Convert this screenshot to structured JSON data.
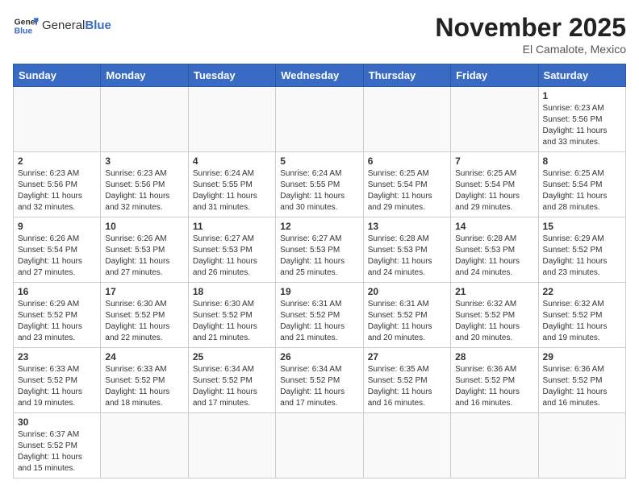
{
  "header": {
    "logo_general": "General",
    "logo_blue": "Blue",
    "month_title": "November 2025",
    "location": "El Camalote, Mexico"
  },
  "weekdays": [
    "Sunday",
    "Monday",
    "Tuesday",
    "Wednesday",
    "Thursday",
    "Friday",
    "Saturday"
  ],
  "weeks": [
    [
      {
        "day": "",
        "info": ""
      },
      {
        "day": "",
        "info": ""
      },
      {
        "day": "",
        "info": ""
      },
      {
        "day": "",
        "info": ""
      },
      {
        "day": "",
        "info": ""
      },
      {
        "day": "",
        "info": ""
      },
      {
        "day": "1",
        "info": "Sunrise: 6:23 AM\nSunset: 5:56 PM\nDaylight: 11 hours\nand 33 minutes."
      }
    ],
    [
      {
        "day": "2",
        "info": "Sunrise: 6:23 AM\nSunset: 5:56 PM\nDaylight: 11 hours\nand 32 minutes."
      },
      {
        "day": "3",
        "info": "Sunrise: 6:23 AM\nSunset: 5:56 PM\nDaylight: 11 hours\nand 32 minutes."
      },
      {
        "day": "4",
        "info": "Sunrise: 6:24 AM\nSunset: 5:55 PM\nDaylight: 11 hours\nand 31 minutes."
      },
      {
        "day": "5",
        "info": "Sunrise: 6:24 AM\nSunset: 5:55 PM\nDaylight: 11 hours\nand 30 minutes."
      },
      {
        "day": "6",
        "info": "Sunrise: 6:25 AM\nSunset: 5:54 PM\nDaylight: 11 hours\nand 29 minutes."
      },
      {
        "day": "7",
        "info": "Sunrise: 6:25 AM\nSunset: 5:54 PM\nDaylight: 11 hours\nand 29 minutes."
      },
      {
        "day": "8",
        "info": "Sunrise: 6:25 AM\nSunset: 5:54 PM\nDaylight: 11 hours\nand 28 minutes."
      }
    ],
    [
      {
        "day": "9",
        "info": "Sunrise: 6:26 AM\nSunset: 5:54 PM\nDaylight: 11 hours\nand 27 minutes."
      },
      {
        "day": "10",
        "info": "Sunrise: 6:26 AM\nSunset: 5:53 PM\nDaylight: 11 hours\nand 27 minutes."
      },
      {
        "day": "11",
        "info": "Sunrise: 6:27 AM\nSunset: 5:53 PM\nDaylight: 11 hours\nand 26 minutes."
      },
      {
        "day": "12",
        "info": "Sunrise: 6:27 AM\nSunset: 5:53 PM\nDaylight: 11 hours\nand 25 minutes."
      },
      {
        "day": "13",
        "info": "Sunrise: 6:28 AM\nSunset: 5:53 PM\nDaylight: 11 hours\nand 24 minutes."
      },
      {
        "day": "14",
        "info": "Sunrise: 6:28 AM\nSunset: 5:53 PM\nDaylight: 11 hours\nand 24 minutes."
      },
      {
        "day": "15",
        "info": "Sunrise: 6:29 AM\nSunset: 5:52 PM\nDaylight: 11 hours\nand 23 minutes."
      }
    ],
    [
      {
        "day": "16",
        "info": "Sunrise: 6:29 AM\nSunset: 5:52 PM\nDaylight: 11 hours\nand 23 minutes."
      },
      {
        "day": "17",
        "info": "Sunrise: 6:30 AM\nSunset: 5:52 PM\nDaylight: 11 hours\nand 22 minutes."
      },
      {
        "day": "18",
        "info": "Sunrise: 6:30 AM\nSunset: 5:52 PM\nDaylight: 11 hours\nand 21 minutes."
      },
      {
        "day": "19",
        "info": "Sunrise: 6:31 AM\nSunset: 5:52 PM\nDaylight: 11 hours\nand 21 minutes."
      },
      {
        "day": "20",
        "info": "Sunrise: 6:31 AM\nSunset: 5:52 PM\nDaylight: 11 hours\nand 20 minutes."
      },
      {
        "day": "21",
        "info": "Sunrise: 6:32 AM\nSunset: 5:52 PM\nDaylight: 11 hours\nand 20 minutes."
      },
      {
        "day": "22",
        "info": "Sunrise: 6:32 AM\nSunset: 5:52 PM\nDaylight: 11 hours\nand 19 minutes."
      }
    ],
    [
      {
        "day": "23",
        "info": "Sunrise: 6:33 AM\nSunset: 5:52 PM\nDaylight: 11 hours\nand 19 minutes."
      },
      {
        "day": "24",
        "info": "Sunrise: 6:33 AM\nSunset: 5:52 PM\nDaylight: 11 hours\nand 18 minutes."
      },
      {
        "day": "25",
        "info": "Sunrise: 6:34 AM\nSunset: 5:52 PM\nDaylight: 11 hours\nand 17 minutes."
      },
      {
        "day": "26",
        "info": "Sunrise: 6:34 AM\nSunset: 5:52 PM\nDaylight: 11 hours\nand 17 minutes."
      },
      {
        "day": "27",
        "info": "Sunrise: 6:35 AM\nSunset: 5:52 PM\nDaylight: 11 hours\nand 16 minutes."
      },
      {
        "day": "28",
        "info": "Sunrise: 6:36 AM\nSunset: 5:52 PM\nDaylight: 11 hours\nand 16 minutes."
      },
      {
        "day": "29",
        "info": "Sunrise: 6:36 AM\nSunset: 5:52 PM\nDaylight: 11 hours\nand 16 minutes."
      }
    ],
    [
      {
        "day": "30",
        "info": "Sunrise: 6:37 AM\nSunset: 5:52 PM\nDaylight: 11 hours\nand 15 minutes."
      },
      {
        "day": "",
        "info": ""
      },
      {
        "day": "",
        "info": ""
      },
      {
        "day": "",
        "info": ""
      },
      {
        "day": "",
        "info": ""
      },
      {
        "day": "",
        "info": ""
      },
      {
        "day": "",
        "info": ""
      }
    ]
  ]
}
